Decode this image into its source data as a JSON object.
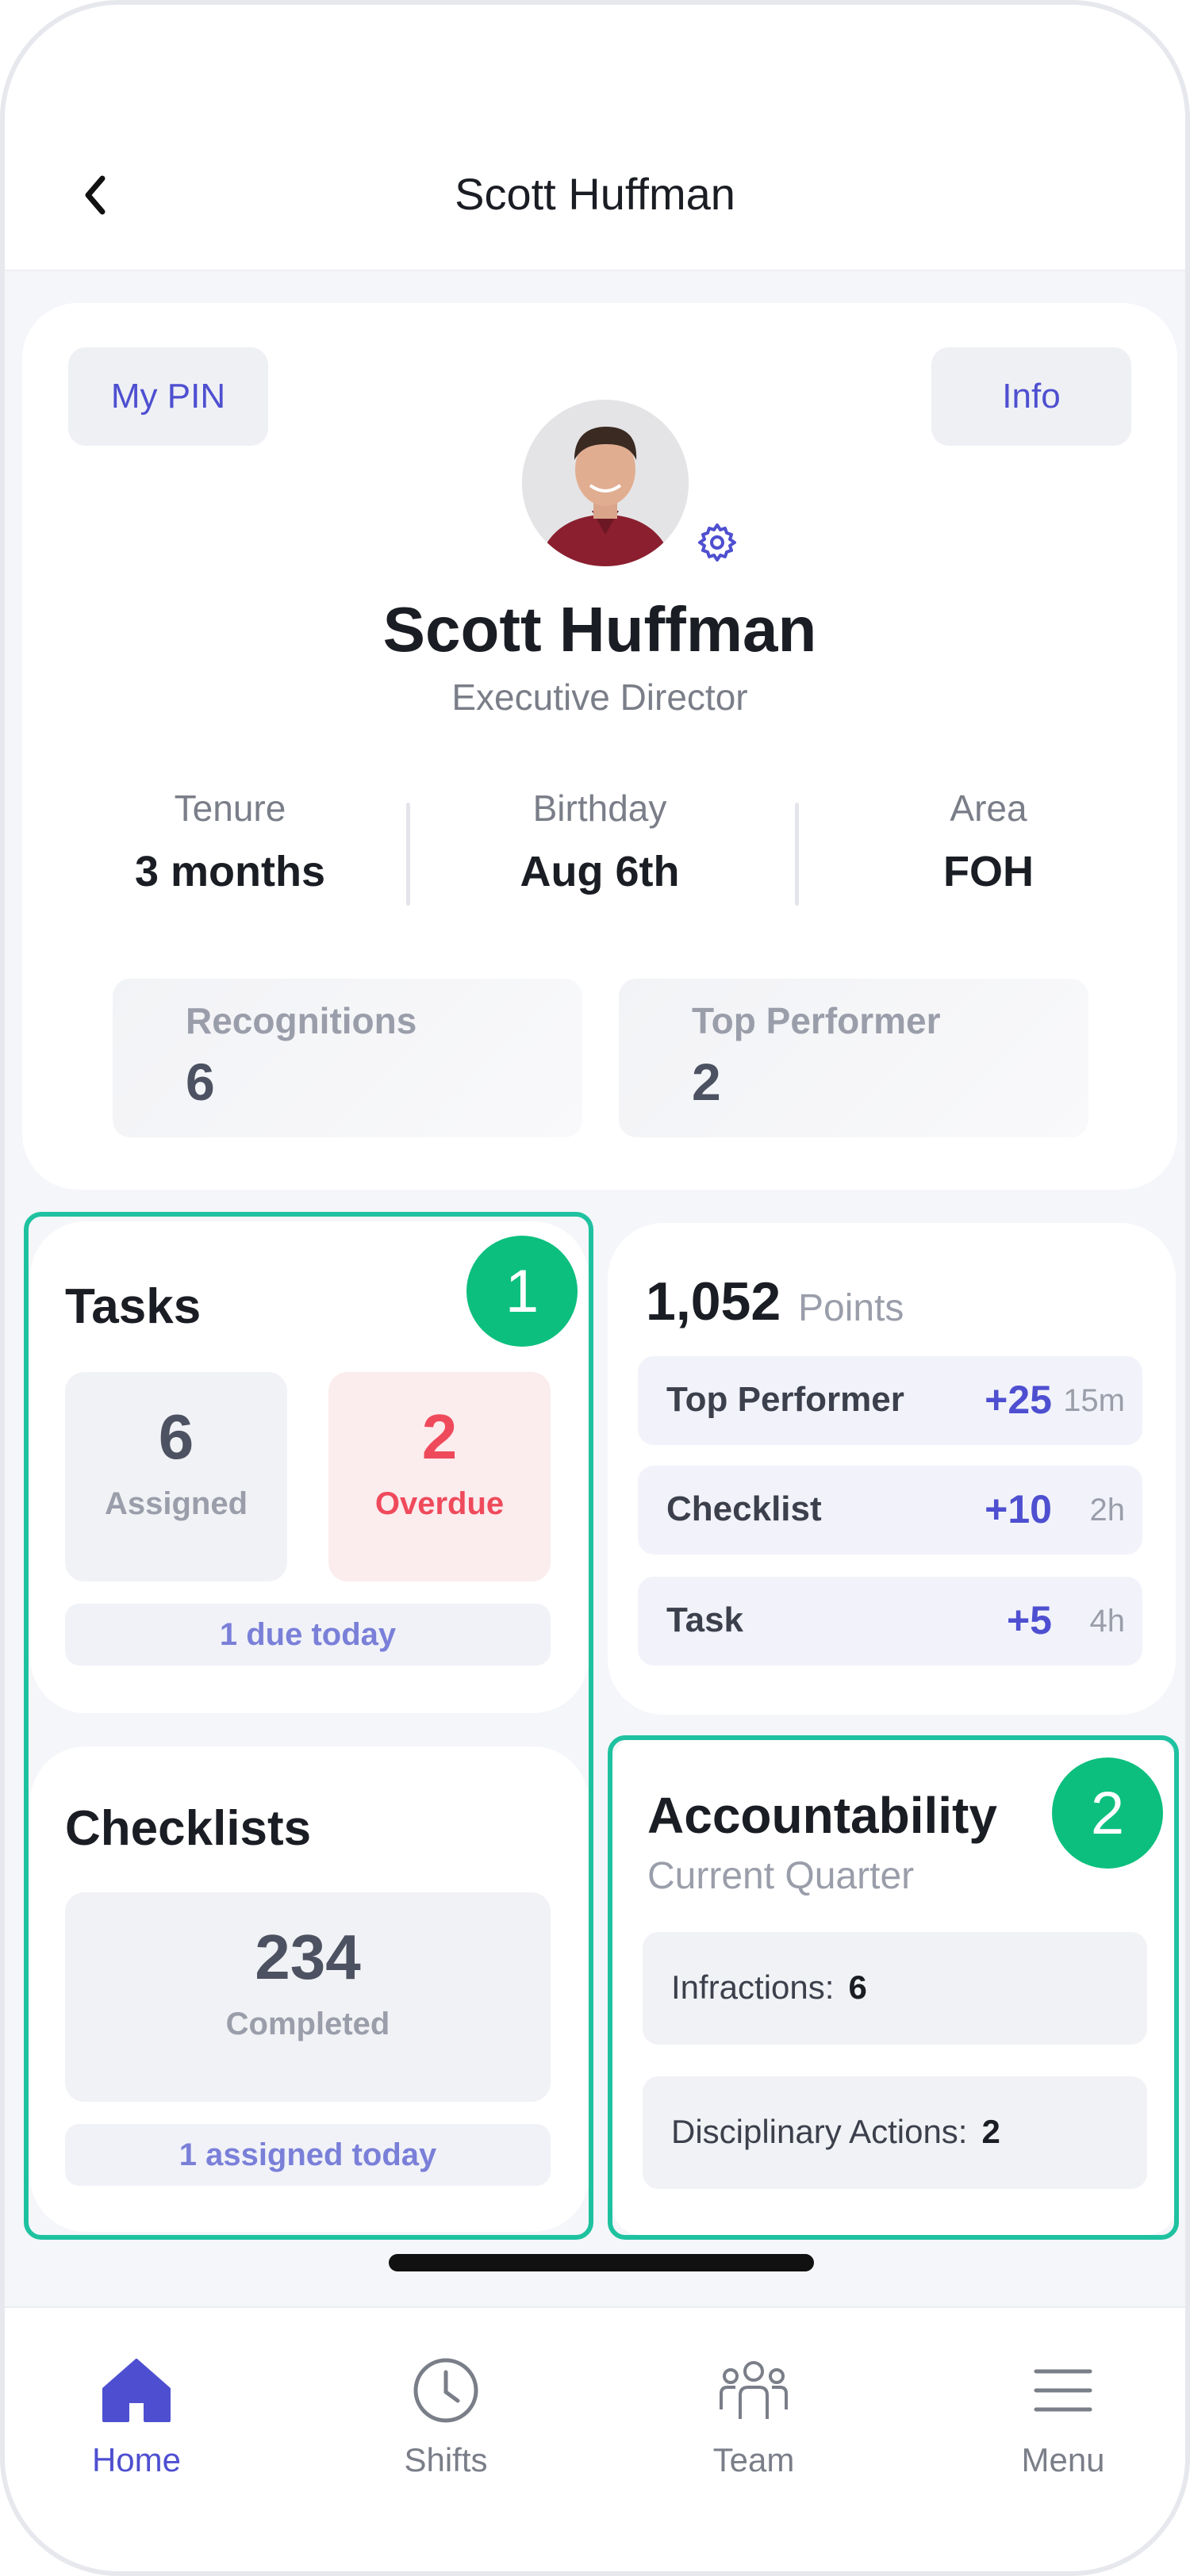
{
  "header": {
    "title": "Scott Huffman"
  },
  "profile": {
    "pin_label": "My PIN",
    "info_label": "Info",
    "name": "Scott Huffman",
    "role": "Executive Director",
    "stats": [
      {
        "label": "Tenure",
        "value": "3 months"
      },
      {
        "label": "Birthday",
        "value": "Aug 6th"
      },
      {
        "label": "Area",
        "value": "FOH"
      }
    ],
    "metrics": [
      {
        "label": "Recognitions",
        "value": "6"
      },
      {
        "label": "Top Performer",
        "value": "2"
      }
    ]
  },
  "tasks": {
    "title": "Tasks",
    "assigned_count": "6",
    "assigned_label": "Assigned",
    "overdue_count": "2",
    "overdue_label": "Overdue",
    "due_text": "1 due today"
  },
  "checklists": {
    "title": "Checklists",
    "completed_count": "234",
    "completed_label": "Completed",
    "assigned_text": "1 assigned today"
  },
  "points": {
    "total": "1,052",
    "unit": "Points",
    "items": [
      {
        "label": "Top Performer",
        "value": "+25",
        "time": "15m"
      },
      {
        "label": "Checklist",
        "value": "+10",
        "time": "2h"
      },
      {
        "label": "Task",
        "value": "+5",
        "time": "4h"
      }
    ]
  },
  "accountability": {
    "title": "Accountability",
    "subtitle": "Current Quarter",
    "rows": [
      {
        "label": "Infractions:",
        "value": "6"
      },
      {
        "label": "Disciplinary Actions:",
        "value": "2"
      }
    ]
  },
  "annotations": {
    "badge1": "1",
    "badge2": "2"
  },
  "tabs": [
    {
      "label": "Home",
      "icon": "home-icon"
    },
    {
      "label": "Shifts",
      "icon": "clock-icon"
    },
    {
      "label": "Team",
      "icon": "team-icon"
    },
    {
      "label": "Menu",
      "icon": "menu-icon"
    }
  ],
  "colors": {
    "accent": "#4e4fd0",
    "danger": "#ef4a5b",
    "highlight": "#1fc2a0",
    "badge": "#0cbf7f"
  }
}
